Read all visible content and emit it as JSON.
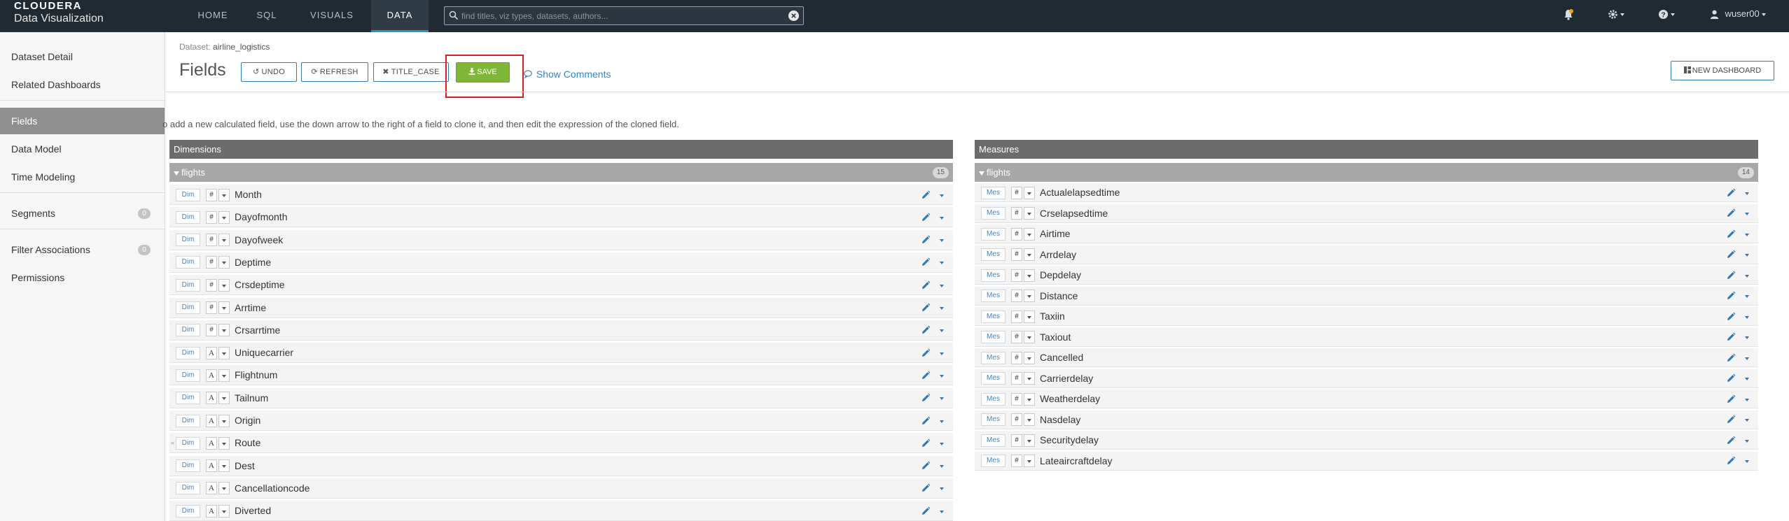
{
  "app": {
    "brand": "CLOUDERA",
    "product": "Data Visualization"
  },
  "nav": {
    "tabs": [
      {
        "label": "HOME"
      },
      {
        "label": "SQL"
      },
      {
        "label": "VISUALS"
      },
      {
        "label": "DATA",
        "active": true
      }
    ],
    "search_placeholder": "find titles, viz types, datasets, authors...",
    "user": "wuser00"
  },
  "sidebar": {
    "items": [
      {
        "label": "Dataset Detail"
      },
      {
        "label": "Related Dashboards"
      },
      {
        "label": "Fields",
        "active": true
      },
      {
        "label": "Data Model"
      },
      {
        "label": "Time Modeling"
      },
      {
        "label": "Segments",
        "badge": "0"
      },
      {
        "label": "Filter Associations",
        "badge": "0"
      },
      {
        "label": "Permissions"
      }
    ]
  },
  "header": {
    "dataset_prefix": "Dataset:",
    "dataset_name": "airline_logistics",
    "title": "Fields",
    "undo_label": "UNDO",
    "refresh_label": "REFRESH",
    "title_case_label": "TITLE_CASE",
    "save_label": "SAVE",
    "show_comments_label": "Show Comments",
    "new_dashboard_label": "NEW DASHBOARD"
  },
  "hint": "o add a new calculated field, use the down arrow to the right of a field to clone it, and then edit the expression of the cloned field.",
  "dimensions": {
    "title": "Dimensions",
    "group": "flights",
    "count": "15",
    "chip_label": "Dim",
    "fields": [
      {
        "name": "Month",
        "type": "#"
      },
      {
        "name": "Dayofmonth",
        "type": "#"
      },
      {
        "name": "Dayofweek",
        "type": "#"
      },
      {
        "name": "Deptime",
        "type": "#"
      },
      {
        "name": "Crsdeptime",
        "type": "#"
      },
      {
        "name": "Arrtime",
        "type": "#"
      },
      {
        "name": "Crsarrtime",
        "type": "#"
      },
      {
        "name": "Uniquecarrier",
        "type": "A"
      },
      {
        "name": "Flightnum",
        "type": "A"
      },
      {
        "name": "Tailnum",
        "type": "A"
      },
      {
        "name": "Origin",
        "type": "A"
      },
      {
        "name": "Route",
        "type": "A"
      },
      {
        "name": "Dest",
        "type": "A"
      },
      {
        "name": "Cancellationcode",
        "type": "A"
      },
      {
        "name": "Diverted",
        "type": "A"
      }
    ]
  },
  "measures": {
    "title": "Measures",
    "group": "flights",
    "count": "14",
    "chip_label": "Mes",
    "fields": [
      {
        "name": "Actualelapsedtime",
        "type": "#"
      },
      {
        "name": "Crselapsedtime",
        "type": "#"
      },
      {
        "name": "Airtime",
        "type": "#"
      },
      {
        "name": "Arrdelay",
        "type": "#"
      },
      {
        "name": "Depdelay",
        "type": "#"
      },
      {
        "name": "Distance",
        "type": "#"
      },
      {
        "name": "Taxiin",
        "type": "#"
      },
      {
        "name": "Taxiout",
        "type": "#"
      },
      {
        "name": "Cancelled",
        "type": "#"
      },
      {
        "name": "Carrierdelay",
        "type": "#"
      },
      {
        "name": "Weatherdelay",
        "type": "#"
      },
      {
        "name": "Nasdelay",
        "type": "#"
      },
      {
        "name": "Securitydelay",
        "type": "#"
      },
      {
        "name": "Lateaircraftdelay",
        "type": "#"
      }
    ]
  },
  "colors": {
    "topbar": "#1f2a33",
    "accent": "#2b8ec8",
    "save": "#80b637",
    "highlight": "#e11b22",
    "link": "#3b83c0"
  }
}
